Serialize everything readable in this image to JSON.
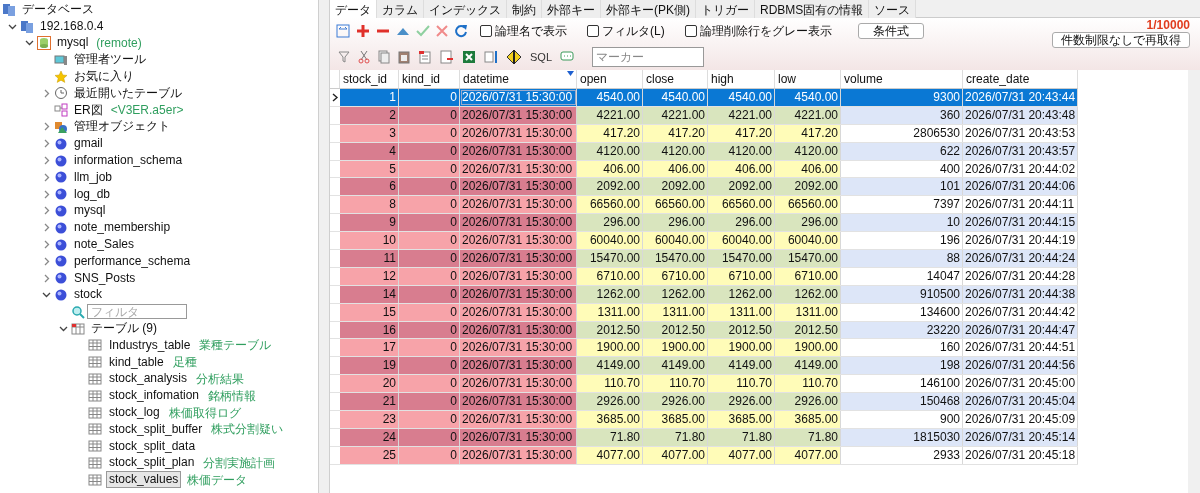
{
  "tree": [
    {
      "label": "データベース",
      "kind": "root",
      "children": [
        {
          "label": "192.168.0.4",
          "kind": "server",
          "expanded": true,
          "children": [
            {
              "label": "mysql",
              "note": "(remote)",
              "kind": "connection",
              "expanded": true,
              "children": [
                {
                  "label": "管理者ツール",
                  "kind": "admin"
                },
                {
                  "label": "お気に入り",
                  "kind": "favorites"
                },
                {
                  "label": "最近開いたテーブル",
                  "kind": "history",
                  "expanded": false
                },
                {
                  "label": "ER図",
                  "note": "<V3ER.a5er>",
                  "kind": "er"
                },
                {
                  "label": "管理オブジェクト",
                  "kind": "objects",
                  "expanded": false
                },
                {
                  "label": "gmail",
                  "kind": "schema",
                  "expanded": false
                },
                {
                  "label": "information_schema",
                  "kind": "schema",
                  "expanded": false
                },
                {
                  "label": "llm_job",
                  "kind": "schema",
                  "expanded": false
                },
                {
                  "label": "log_db",
                  "kind": "schema",
                  "expanded": false
                },
                {
                  "label": "mysql",
                  "kind": "schema",
                  "expanded": false
                },
                {
                  "label": "note_membership",
                  "kind": "schema",
                  "expanded": false
                },
                {
                  "label": "note_Sales",
                  "kind": "schema",
                  "expanded": false
                },
                {
                  "label": "performance_schema",
                  "kind": "schema",
                  "expanded": false
                },
                {
                  "label": "SNS_Posts",
                  "kind": "schema",
                  "expanded": false
                },
                {
                  "label": "stock",
                  "kind": "schema",
                  "expanded": true,
                  "children": [
                    {
                      "kind": "filter",
                      "placeholder": "フィルタ"
                    },
                    {
                      "label": "テーブル (9)",
                      "kind": "table-group",
                      "expanded": true,
                      "children": [
                        {
                          "label": "Industrys_table",
                          "note": "業種テーブル",
                          "kind": "table",
                          "selected": false
                        },
                        {
                          "label": "kind_table",
                          "note": "足種",
                          "kind": "table",
                          "selected": false
                        },
                        {
                          "label": "stock_analysis",
                          "note": "分析結果",
                          "kind": "table",
                          "selected": false
                        },
                        {
                          "label": "stock_infomation",
                          "note": "銘柄情報",
                          "kind": "table",
                          "selected": false
                        },
                        {
                          "label": "stock_log",
                          "note": "株価取得ログ",
                          "kind": "table",
                          "selected": false
                        },
                        {
                          "label": "stock_split_buffer",
                          "note": "株式分割疑い",
                          "kind": "table",
                          "selected": false
                        },
                        {
                          "label": "stock_split_data",
                          "kind": "table",
                          "selected": false
                        },
                        {
                          "label": "stock_split_plan",
                          "note": "分割実施計画",
                          "kind": "table",
                          "selected": false
                        },
                        {
                          "label": "stock_values",
                          "note": "株価データ",
                          "kind": "table",
                          "selected": true
                        }
                      ]
                    }
                  ]
                }
              ]
            }
          ]
        }
      ]
    }
  ],
  "tabs": [
    {
      "label": "データ",
      "selected": true
    },
    {
      "label": "カラム",
      "selected": false
    },
    {
      "label": "インデックス",
      "selected": false
    },
    {
      "label": "制約",
      "selected": false
    },
    {
      "label": "外部キー",
      "selected": false
    },
    {
      "label": "外部キー(PK側)",
      "selected": false
    },
    {
      "label": "トリガー",
      "selected": false
    },
    {
      "label": "RDBMS固有の情報",
      "selected": false
    },
    {
      "label": "ソース",
      "selected": false
    }
  ],
  "toolbar": {
    "checkboxes": [
      {
        "label": "論理名で表示",
        "checked": false
      },
      {
        "label": "フィルタ(L)",
        "checked": false
      },
      {
        "label": "論理削除行をグレー表示",
        "checked": false
      }
    ],
    "condition_button": "条件式",
    "record_count": "1/10000",
    "refetch_button": "件数制限なしで再取得",
    "sql_button": "SQL",
    "marker_field": {
      "placeholder": "マーカー"
    }
  },
  "table": {
    "columns": [
      {
        "label": "stock_id",
        "sorted": false
      },
      {
        "label": "kind_id",
        "sorted": false
      },
      {
        "label": "datetime",
        "sorted": true
      },
      {
        "label": "open",
        "sorted": false
      },
      {
        "label": "close",
        "sorted": false
      },
      {
        "label": "high",
        "sorted": false
      },
      {
        "label": "low",
        "sorted": false
      },
      {
        "label": "volume",
        "sorted": false
      },
      {
        "label": "create_date",
        "sorted": false
      }
    ],
    "rows": [
      {
        "selected": true,
        "cells": [
          "1",
          "0",
          "2026/07/31 15:30:00",
          "4540.00",
          "4540.00",
          "4540.00",
          "4540.00",
          "9300",
          "2026/07/31 20:43:44"
        ]
      },
      {
        "selected": false,
        "cells": [
          "2",
          "0",
          "2026/07/31 15:30:00",
          "4221.00",
          "4221.00",
          "4221.00",
          "4221.00",
          "360",
          "2026/07/31 20:43:48"
        ]
      },
      {
        "selected": false,
        "cells": [
          "3",
          "0",
          "2026/07/31 15:30:00",
          "417.20",
          "417.20",
          "417.20",
          "417.20",
          "2806530",
          "2026/07/31 20:43:53"
        ]
      },
      {
        "selected": false,
        "cells": [
          "4",
          "0",
          "2026/07/31 15:30:00",
          "4120.00",
          "4120.00",
          "4120.00",
          "4120.00",
          "622",
          "2026/07/31 20:43:57"
        ]
      },
      {
        "selected": false,
        "cells": [
          "5",
          "0",
          "2026/07/31 15:30:00",
          "406.00",
          "406.00",
          "406.00",
          "406.00",
          "400",
          "2026/07/31 20:44:02"
        ]
      },
      {
        "selected": false,
        "cells": [
          "6",
          "0",
          "2026/07/31 15:30:00",
          "2092.00",
          "2092.00",
          "2092.00",
          "2092.00",
          "101",
          "2026/07/31 20:44:06"
        ]
      },
      {
        "selected": false,
        "cells": [
          "8",
          "0",
          "2026/07/31 15:30:00",
          "66560.00",
          "66560.00",
          "66560.00",
          "66560.00",
          "7397",
          "2026/07/31 20:44:11"
        ]
      },
      {
        "selected": false,
        "cells": [
          "9",
          "0",
          "2026/07/31 15:30:00",
          "296.00",
          "296.00",
          "296.00",
          "296.00",
          "10",
          "2026/07/31 20:44:15"
        ]
      },
      {
        "selected": false,
        "cells": [
          "10",
          "0",
          "2026/07/31 15:30:00",
          "60040.00",
          "60040.00",
          "60040.00",
          "60040.00",
          "196",
          "2026/07/31 20:44:19"
        ]
      },
      {
        "selected": false,
        "cells": [
          "11",
          "0",
          "2026/07/31 15:30:00",
          "15470.00",
          "15470.00",
          "15470.00",
          "15470.00",
          "88",
          "2026/07/31 20:44:24"
        ]
      },
      {
        "selected": false,
        "cells": [
          "12",
          "0",
          "2026/07/31 15:30:00",
          "6710.00",
          "6710.00",
          "6710.00",
          "6710.00",
          "14047",
          "2026/07/31 20:44:28"
        ]
      },
      {
        "selected": false,
        "cells": [
          "14",
          "0",
          "2026/07/31 15:30:00",
          "1262.00",
          "1262.00",
          "1262.00",
          "1262.00",
          "910500",
          "2026/07/31 20:44:38"
        ]
      },
      {
        "selected": false,
        "cells": [
          "15",
          "0",
          "2026/07/31 15:30:00",
          "1311.00",
          "1311.00",
          "1311.00",
          "1311.00",
          "134600",
          "2026/07/31 20:44:42"
        ]
      },
      {
        "selected": false,
        "cells": [
          "16",
          "0",
          "2026/07/31 15:30:00",
          "2012.50",
          "2012.50",
          "2012.50",
          "2012.50",
          "23220",
          "2026/07/31 20:44:47"
        ]
      },
      {
        "selected": false,
        "cells": [
          "17",
          "0",
          "2026/07/31 15:30:00",
          "1900.00",
          "1900.00",
          "1900.00",
          "1900.00",
          "160",
          "2026/07/31 20:44:51"
        ]
      },
      {
        "selected": false,
        "cells": [
          "19",
          "0",
          "2026/07/31 15:30:00",
          "4149.00",
          "4149.00",
          "4149.00",
          "4149.00",
          "198",
          "2026/07/31 20:44:56"
        ]
      },
      {
        "selected": false,
        "cells": [
          "20",
          "0",
          "2026/07/31 15:30:00",
          "110.70",
          "110.70",
          "110.70",
          "110.70",
          "146100",
          "2026/07/31 20:45:00"
        ]
      },
      {
        "selected": false,
        "cells": [
          "21",
          "0",
          "2026/07/31 15:30:00",
          "2926.00",
          "2926.00",
          "2926.00",
          "2926.00",
          "150468",
          "2026/07/31 20:45:04"
        ]
      },
      {
        "selected": false,
        "cells": [
          "23",
          "0",
          "2026/07/31 15:30:00",
          "3685.00",
          "3685.00",
          "3685.00",
          "3685.00",
          "900",
          "2026/07/31 20:45:09"
        ]
      },
      {
        "selected": false,
        "cells": [
          "24",
          "0",
          "2026/07/31 15:30:00",
          "71.80",
          "71.80",
          "71.80",
          "71.80",
          "1815030",
          "2026/07/31 20:45:14"
        ]
      },
      {
        "selected": false,
        "cells": [
          "25",
          "0",
          "2026/07/31 15:30:00",
          "4077.00",
          "4077.00",
          "4077.00",
          "4077.00",
          "2933",
          "2026/07/31 20:45:18"
        ]
      }
    ]
  }
}
